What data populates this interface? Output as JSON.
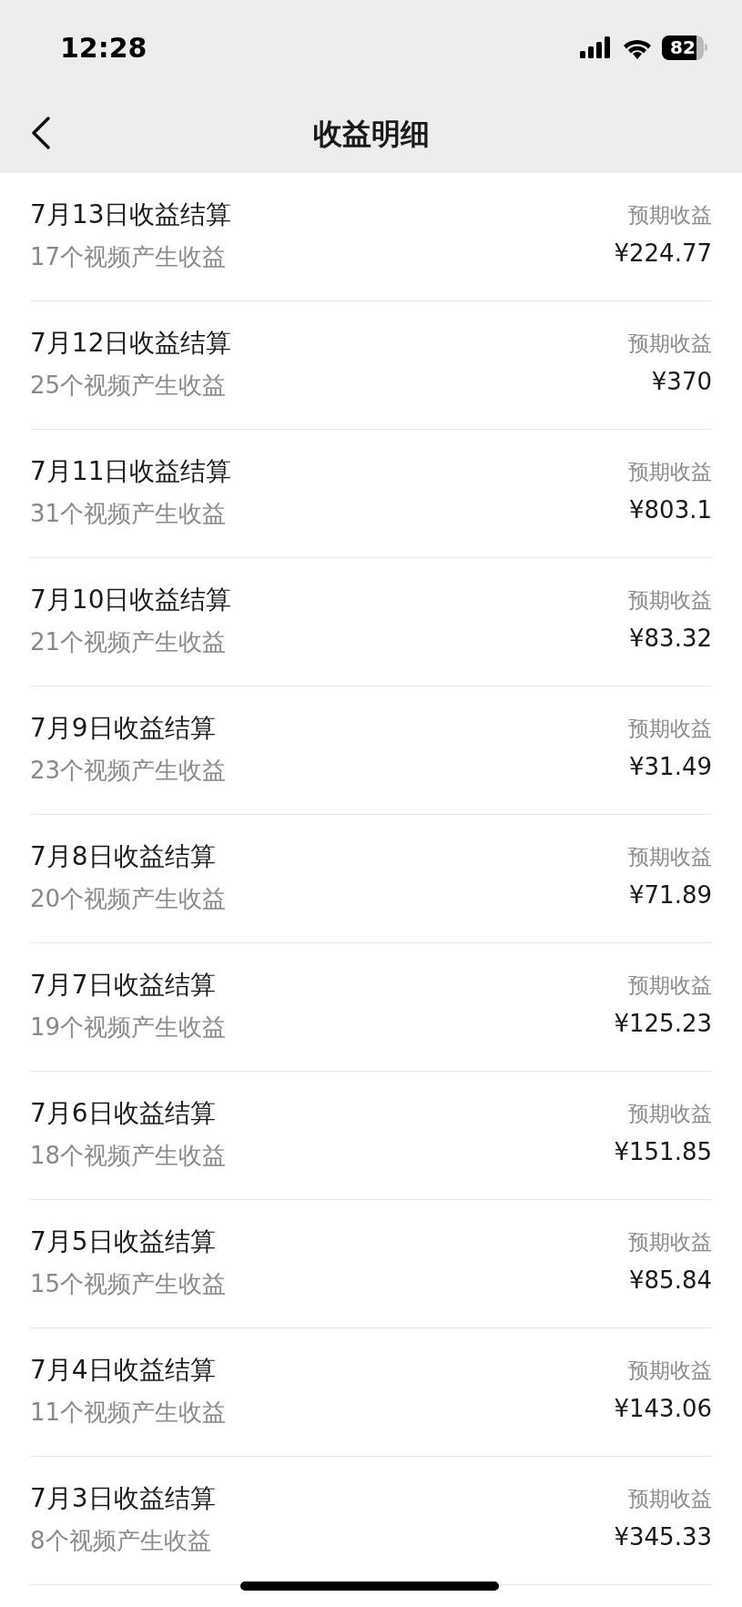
{
  "status_bar": {
    "time": "12:28",
    "battery": "82"
  },
  "nav": {
    "title": "收益明细"
  },
  "rows": [
    {
      "title": "7月13日收益结算",
      "subtitle": "17个视频产生收益",
      "label": "预期收益",
      "amount": "¥224.77"
    },
    {
      "title": "7月12日收益结算",
      "subtitle": "25个视频产生收益",
      "label": "预期收益",
      "amount": "¥370"
    },
    {
      "title": "7月11日收益结算",
      "subtitle": "31个视频产生收益",
      "label": "预期收益",
      "amount": "¥803.1"
    },
    {
      "title": "7月10日收益结算",
      "subtitle": "21个视频产生收益",
      "label": "预期收益",
      "amount": "¥83.32"
    },
    {
      "title": "7月9日收益结算",
      "subtitle": "23个视频产生收益",
      "label": "预期收益",
      "amount": "¥31.49"
    },
    {
      "title": "7月8日收益结算",
      "subtitle": "20个视频产生收益",
      "label": "预期收益",
      "amount": "¥71.89"
    },
    {
      "title": "7月7日收益结算",
      "subtitle": "19个视频产生收益",
      "label": "预期收益",
      "amount": "¥125.23"
    },
    {
      "title": "7月6日收益结算",
      "subtitle": "18个视频产生收益",
      "label": "预期收益",
      "amount": "¥151.85"
    },
    {
      "title": "7月5日收益结算",
      "subtitle": "15个视频产生收益",
      "label": "预期收益",
      "amount": "¥85.84"
    },
    {
      "title": "7月4日收益结算",
      "subtitle": "11个视频产生收益",
      "label": "预期收益",
      "amount": "¥143.06"
    },
    {
      "title": "7月3日收益结算",
      "subtitle": "8个视频产生收益",
      "label": "预期收益",
      "amount": "¥345.33"
    }
  ]
}
